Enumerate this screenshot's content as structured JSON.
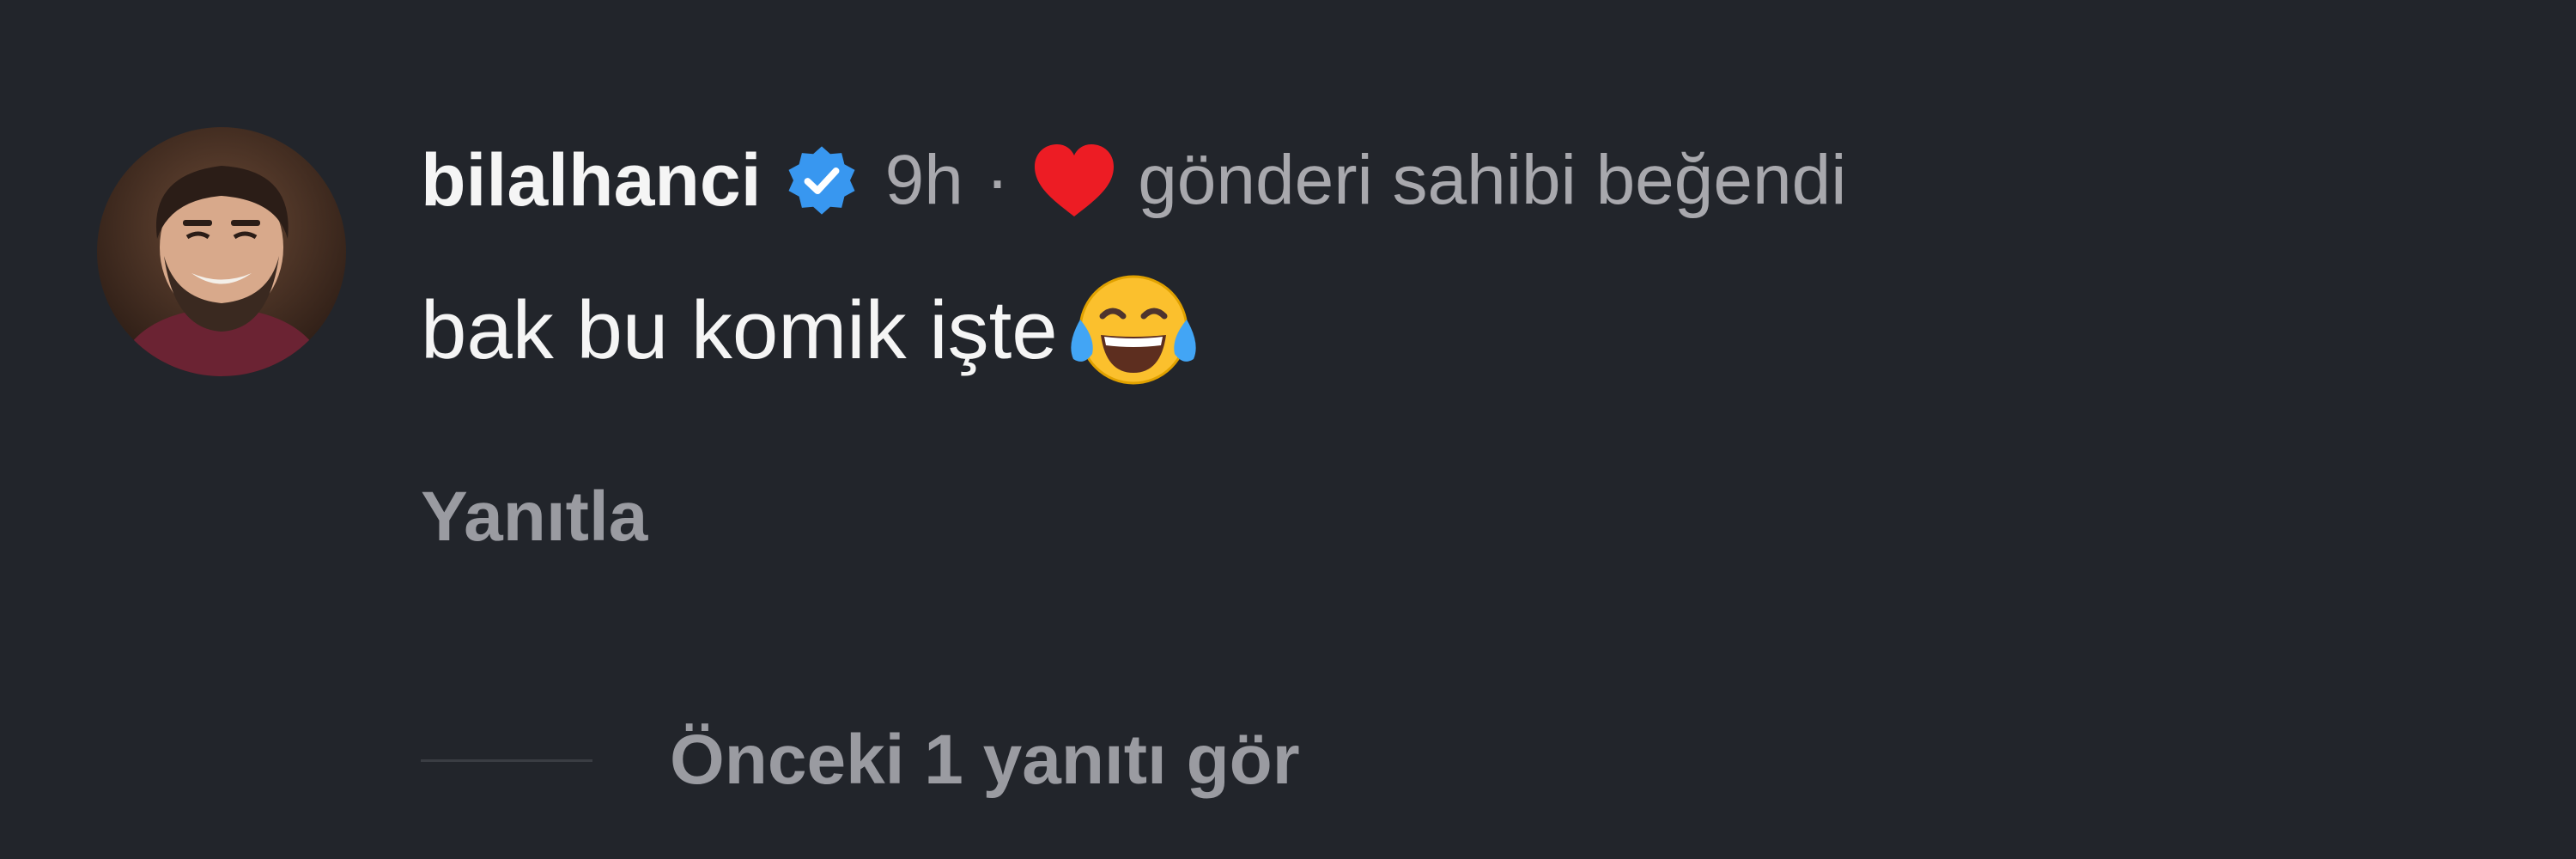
{
  "comment": {
    "username": "bilalhanci",
    "verified": true,
    "time": "9h",
    "separator": "·",
    "liked_by_author_text": "gönderi sahibi beğendi",
    "text": "bak bu komik işte",
    "emoji": "face-with-tears-of-joy",
    "reply_label": "Yanıtla",
    "view_replies_label": "Önceki 1 yanıtı gör"
  },
  "icons": {
    "verified": "verified-badge-icon",
    "heart": "heart-icon",
    "emoji": "tears-of-joy-emoji-icon"
  },
  "colors": {
    "background": "#22252b",
    "primary_text": "#f5f5f5",
    "secondary_text": "#a8a8ad",
    "verified_blue": "#3897f0",
    "heart_red": "#ed1c24"
  }
}
